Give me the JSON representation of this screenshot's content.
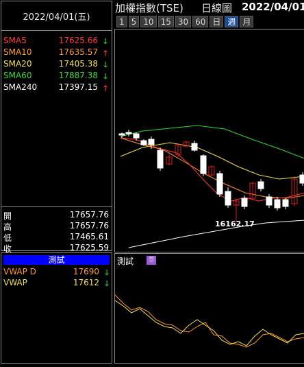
{
  "header": {
    "date": "2022/04/01(五)",
    "title": "加權指數(TSE)",
    "period": "日線圖",
    "chart_date": "2022/04/01"
  },
  "period_buttons": [
    "1",
    "5",
    "10",
    "15",
    "30",
    "60",
    "日",
    "週",
    "月"
  ],
  "period_active_index": 7,
  "moving_averages": [
    {
      "label": "SMA5",
      "value": "17625.66",
      "dir": "down",
      "color": "#ff3b3b"
    },
    {
      "label": "SMA10",
      "value": "17635.57",
      "dir": "up",
      "color": "#ff9a2e"
    },
    {
      "label": "SMA20",
      "value": "17405.38",
      "dir": "down",
      "color": "#f0e05a"
    },
    {
      "label": "SMA60",
      "value": "17887.38",
      "dir": "down",
      "color": "#3ed43e"
    },
    {
      "label": "SMA240",
      "value": "17397.15",
      "dir": "up",
      "color": "#ffffff"
    }
  ],
  "ohlc": [
    {
      "label": "開",
      "value": "17657.76"
    },
    {
      "label": "高",
      "value": "17657.76"
    },
    {
      "label": "低",
      "value": "17465.61"
    },
    {
      "label": "收",
      "value": "17625.59"
    }
  ],
  "indicator_panel": {
    "title": "測試",
    "rows": [
      {
        "label": "VWAP D",
        "value": "17690",
        "dir": "down",
        "color": "#ff9a2e"
      },
      {
        "label": "VWAP",
        "value": "17612",
        "dir": "down",
        "color": "#f0e05a"
      }
    ]
  },
  "chart": {
    "low_label": "16162.17",
    "colors": {
      "up": "#d62020",
      "down": "#ffffff",
      "sma5": "#ff3b3b",
      "sma10": "#ff9a2e",
      "sma20": "#f0e05a",
      "sma60": "#3ed43e",
      "sma240": "#ffffff"
    }
  },
  "oscillator": {
    "title": "測試",
    "icon": "settings-icon",
    "line_colors": [
      "#ff9a2e",
      "#f0e05a"
    ]
  },
  "arrows": {
    "up": "🡑",
    "down": "🡓"
  },
  "arrow_colors": {
    "up": "#ff3b3b",
    "down": "#3ec43e"
  }
}
